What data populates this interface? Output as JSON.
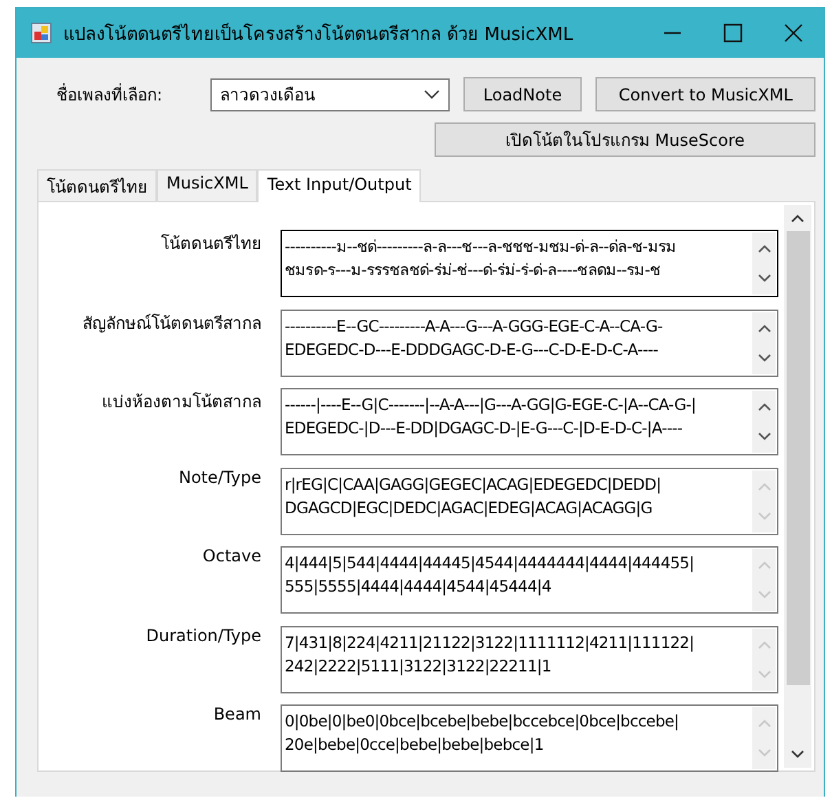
{
  "window": {
    "title": "แปลงโน้ตดนตรีไทยเป็นโครงสร้างโน้ตดนตรีสากล ด้วย MusicXML"
  },
  "song": {
    "label": "ชื่อเพลงที่เลือก:",
    "value": "ลาวดวงเดือน"
  },
  "buttons": [
    "LoadNote",
    "Convert to MusicXML",
    "เปิดโน้ตในโปรแกรม MuseScore"
  ],
  "tabs": [
    {
      "label": "โน้ตดนตรีไทย",
      "selected": false
    },
    {
      "label": "MusicXML",
      "selected": false
    },
    {
      "label": "Text Input/Output",
      "selected": true
    }
  ],
  "fields": [
    {
      "label": "โน้ตดนตรีไทย",
      "value": "----------ม--ชด่---------ล-ล---ช---ล-ชชช-มชม-ด่-ล--ด่ล-ช-มรม\nชมรด-ร---ม-รรรชลชด่-ร่ม่-ช่---ด่-ร่ม่-ร่-ด่-ล----ชลดม--รม-ช",
      "focused": true,
      "scrollable": true
    },
    {
      "label": "สัญลักษณ์โน้ตดนตรีสากล",
      "value": "----------E--GC---------A-A---G---A-GGG-EGE-C-A--CA-G-\nEDEGEDC-D---E-DDDGAGC-D-E-G---C-D-E-D-C-A----",
      "focused": false,
      "scrollable": true
    },
    {
      "label": "แบ่งห้องตามโน้ตสากล",
      "value": "------|----E--G|C-------|--A-A---|G---A-GG|G-EGE-C-|A--CA-G-|\nEDEGEDC-|D---E-DD|DGAGC-D-|E-G---C-|D-E-D-C-|A----",
      "focused": false,
      "scrollable": true
    },
    {
      "label": "Note/Type",
      "value": "r|rEG|C|CAA|GAGG|GEGEC|ACAG|EDEGEDC|DEDD|\nDGAGCD|EGC|DEDC|AGAC|EDEG|ACAG|ACAGG|G",
      "focused": false,
      "scrollable": false
    },
    {
      "label": "Octave",
      "value": "4|444|5|544|4444|44445|4544|4444444|4444|444455|\n555|5555|4444|4444|4544|45444|4",
      "focused": false,
      "scrollable": false
    },
    {
      "label": "Duration/Type",
      "value": "7|431|8|224|4211|21122|3122|1111112|4211|111122|\n242|2222|5111|3122|3122|22211|1",
      "focused": false,
      "scrollable": false
    },
    {
      "label": "Beam",
      "value": "0|0be|0|be0|0bce|bcebe|bebe|bccebce|0bce|bccebe|\n20e|bebe|0cce|bebe|bebe|bebce|1",
      "focused": false,
      "scrollable": false
    }
  ]
}
